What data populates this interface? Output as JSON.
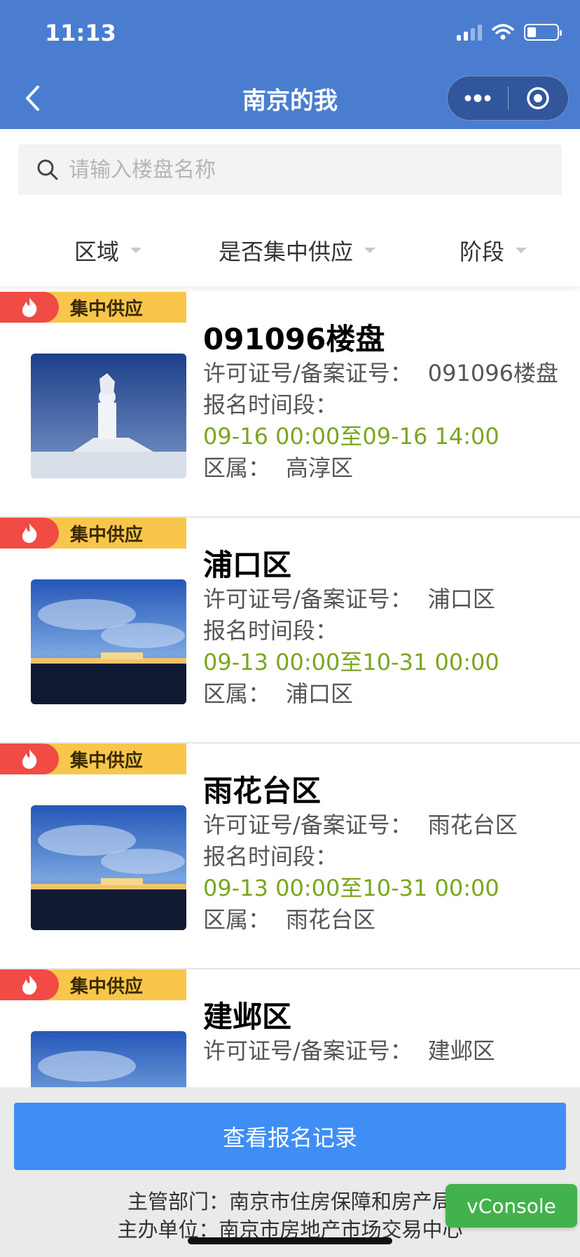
{
  "status_bar": {
    "time": "11:13"
  },
  "nav": {
    "title": "南京的我"
  },
  "search": {
    "placeholder": "请输入楼盘名称"
  },
  "filters": [
    {
      "label": "区域"
    },
    {
      "label": "是否集中供应"
    },
    {
      "label": "阶段"
    }
  ],
  "tag_label": "集中供应",
  "labels": {
    "permit": "许可证号/备案证号：",
    "signup": "报名时间段：",
    "district": "区属："
  },
  "listings": [
    {
      "name": "091096楼盘",
      "permit": "091096楼盘",
      "time_range": "09-16 00:00至09-16 14:00",
      "district": "高淳区"
    },
    {
      "name": "浦口区",
      "permit": "浦口区",
      "time_range": "09-13 00:00至10-31 00:00",
      "district": "浦口区"
    },
    {
      "name": "雨花台区",
      "permit": "雨花台区",
      "time_range": "09-13 00:00至10-31 00:00",
      "district": "雨花台区"
    },
    {
      "name": "建邺区",
      "permit": "建邺区",
      "time_range": "",
      "district": ""
    }
  ],
  "bottom": {
    "records_button": "查看报名记录",
    "footer_line1": "主管部门：南京市住房保障和房产局",
    "footer_line2": "主办单位：南京市房地产市场交易中心"
  },
  "vconsole": "vConsole",
  "colors": {
    "nav_bg": "#4a7dd0",
    "tag_bg": "#f7c64b",
    "fire_bg": "#f04b45",
    "time_range": "#7aa61e",
    "button": "#3f8ef5",
    "vconsole": "#42b24d"
  }
}
